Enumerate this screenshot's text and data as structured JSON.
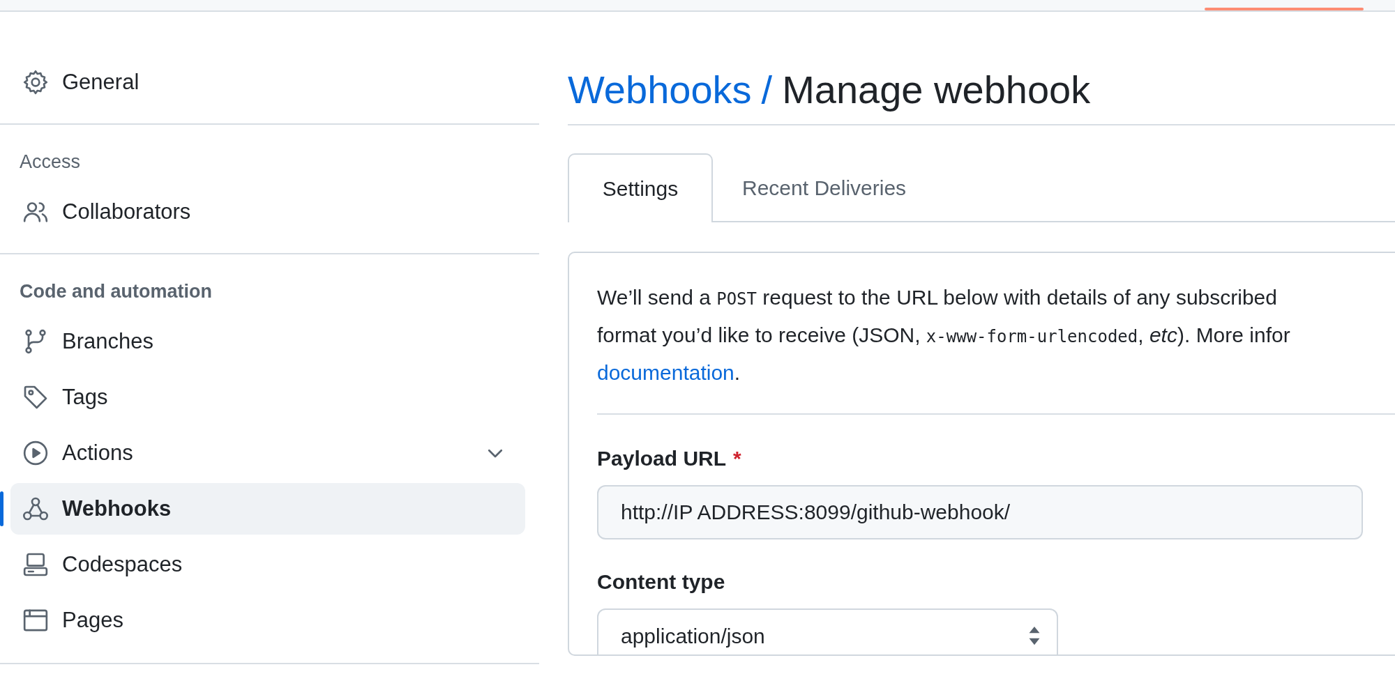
{
  "sidebar": {
    "sections": [
      {
        "items": [
          {
            "label": "General",
            "selected": false
          }
        ]
      },
      {
        "heading": "Access",
        "items": [
          {
            "label": "Collaborators",
            "selected": false
          }
        ]
      },
      {
        "heading": "Code and automation",
        "items": [
          {
            "label": "Branches",
            "selected": false
          },
          {
            "label": "Tags",
            "selected": false
          },
          {
            "label": "Actions",
            "selected": false,
            "expanded": false
          },
          {
            "label": "Webhooks",
            "selected": true
          },
          {
            "label": "Codespaces",
            "selected": false
          },
          {
            "label": "Pages",
            "selected": false
          }
        ]
      }
    ]
  },
  "breadcrumb": {
    "parent": "Webhooks",
    "separator": "/",
    "current": "Manage webhook"
  },
  "tabs": [
    {
      "label": "Settings",
      "selected": true
    },
    {
      "label": "Recent Deliveries",
      "selected": false
    }
  ],
  "intro": {
    "lines": [
      [
        {
          "kind": "text",
          "text": "We’ll send a "
        },
        {
          "kind": "code",
          "text": "POST"
        },
        {
          "kind": "text",
          "text": " request to the URL below with details of any subscribed"
        }
      ],
      [
        {
          "kind": "text",
          "text": "format you’d like to receive (JSON, "
        },
        {
          "kind": "code",
          "text": "x-www-form-urlencoded"
        },
        {
          "kind": "text",
          "text": ", "
        },
        {
          "kind": "italic",
          "text": "etc"
        },
        {
          "kind": "text",
          "text": "). More infor"
        }
      ],
      [
        {
          "kind": "link",
          "text": "documentation"
        },
        {
          "kind": "text",
          "text": "."
        }
      ]
    ]
  },
  "fields": [
    {
      "kind": "text",
      "label": "Payload URL",
      "required_mark": "*",
      "value": "http://IP ADDRESS:8099/github-webhook/"
    },
    {
      "kind": "select",
      "label": "Content type",
      "value": "application/json"
    }
  ]
}
